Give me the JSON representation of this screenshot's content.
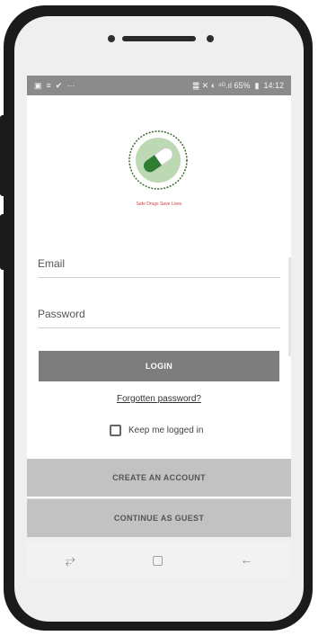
{
  "statusbar": {
    "left_icons": [
      "image-icon",
      "message-icon",
      "twitter-icon"
    ],
    "left_dots": "···",
    "right_icons": [
      "nfc-icon",
      "mute-icon",
      "alarm-icon",
      "signal-icon"
    ],
    "right_text": "䷀ ✕ ◐ ⁴ᴳ.ıl 65%",
    "battery": "▮",
    "time": "14:12"
  },
  "logo": {
    "icon": "capsule-logo-icon",
    "tagline": "Safe Drugs Save Lives",
    "colors": {
      "green": "#2e7d32",
      "ring": "#9fc79a"
    }
  },
  "form": {
    "email_placeholder": "Email",
    "password_placeholder": "Password",
    "login_label": "LOGIN",
    "forgot_label": "Forgotten password?",
    "keep_logged_label": "Keep me logged in"
  },
  "actions": {
    "create_label": "CREATE AN ACCOUNT",
    "guest_label": "CONTINUE AS GUEST"
  },
  "navbar": {
    "recent_icon": "recent-apps-icon",
    "home_icon": "home-icon",
    "back_icon": "back-icon",
    "recent_glyph": "⥂",
    "home_glyph": "▢",
    "back_glyph": "←"
  }
}
